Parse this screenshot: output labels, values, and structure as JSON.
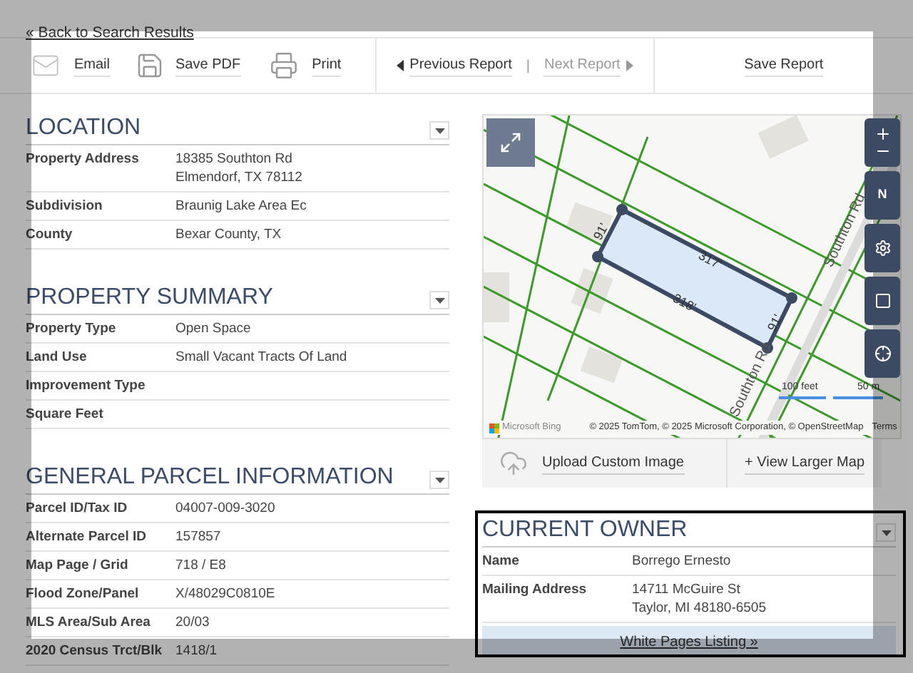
{
  "back_link": "« Back to Search Results",
  "toolbar": {
    "actions": [
      {
        "kind": "email",
        "label": "Email"
      },
      {
        "kind": "pdf",
        "label": "Save PDF"
      },
      {
        "kind": "print",
        "label": "Print"
      }
    ],
    "nav": [
      {
        "kind": "previous",
        "label": "Previous Report",
        "disabled": false
      },
      {
        "kind": "next",
        "label": "Next Report",
        "disabled": true
      }
    ],
    "separator": "|",
    "save": "Save Report"
  },
  "sections": [
    {
      "title": "LOCATION",
      "rows": [
        {
          "label": "Property Address",
          "value": [
            "18385 Southton Rd",
            "Elmendorf, TX 78112"
          ]
        },
        {
          "label": "Subdivision",
          "value": [
            "Braunig Lake Area Ec"
          ]
        },
        {
          "label": "County",
          "value": [
            "Bexar County, TX"
          ]
        }
      ]
    },
    {
      "title": "PROPERTY SUMMARY",
      "rows": [
        {
          "label": "Property Type",
          "value": [
            "Open Space"
          ]
        },
        {
          "label": "Land Use",
          "value": [
            "Small Vacant Tracts Of Land"
          ]
        },
        {
          "label": "Improvement Type"
        },
        {
          "label": "Square Feet"
        }
      ]
    },
    {
      "title": "GENERAL PARCEL INFORMATION",
      "rows": [
        {
          "label": "Parcel ID/Tax ID",
          "value": [
            "04007-009-3020"
          ]
        },
        {
          "label": "Alternate Parcel ID",
          "value": [
            "157857"
          ]
        },
        {
          "label": "Map Page / Grid",
          "value": [
            "718 / E8"
          ]
        },
        {
          "label": "Flood Zone/Panel",
          "value": [
            "X/48029C0810E"
          ]
        },
        {
          "label": "MLS Area/Sub Area",
          "value": [
            "20/03"
          ]
        },
        {
          "label": "2020 Census Trct/Blk",
          "value": [
            "1418/1"
          ]
        }
      ]
    }
  ],
  "map": {
    "lot_lengths": [
      "317'",
      "318'",
      "91'",
      "91'"
    ],
    "roads": [
      "Southton Rd",
      "Southton Rd"
    ],
    "compass": "N",
    "scale": [
      "100 feet",
      "50 m"
    ],
    "provider": "Microsoft Bing",
    "attribution": "© 2025 TomTom, © 2025 Microsoft Corporation, © OpenStreetMap",
    "terms": "Terms"
  },
  "map_actions": [
    {
      "kind": "upload",
      "label": "Upload Custom Image"
    },
    {
      "kind": "larger",
      "label": "+ View Larger Map"
    }
  ],
  "owner": {
    "title": "CURRENT OWNER",
    "rows": [
      {
        "label": "Name",
        "value": [
          "Borrego Ernesto"
        ]
      },
      {
        "label": "Mailing Address",
        "value": [
          "14711 McGuire St",
          "Taylor, MI 48180-6505"
        ]
      }
    ],
    "link": "White Pages Listing »"
  }
}
